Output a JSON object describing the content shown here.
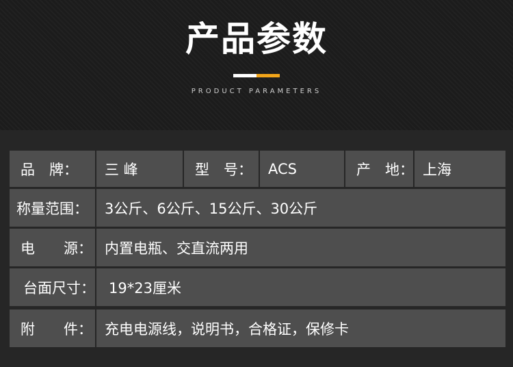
{
  "header": {
    "title": "产品参数",
    "subtitle": "PRODUCT PARAMETERS",
    "accent_colors": [
      "#ffffff",
      "#f2a51a"
    ]
  },
  "rows": [
    {
      "cells": [
        {
          "label": "品　牌：",
          "value": "三 峰"
        },
        {
          "label": "型　号：",
          "value": "ACS"
        },
        {
          "label": "产　地：",
          "value": "上海"
        }
      ]
    },
    {
      "label": "称量范围：",
      "value": "3公斤、6公斤、15公斤、30公斤"
    },
    {
      "label": "电　　源：",
      "value": "内置电瓶、交直流两用"
    },
    {
      "label": "台面尺寸：",
      "value": "19*23厘米"
    },
    {
      "label": "附　　件：",
      "value": "充电电源线，说明书，合格证，保修卡"
    }
  ]
}
